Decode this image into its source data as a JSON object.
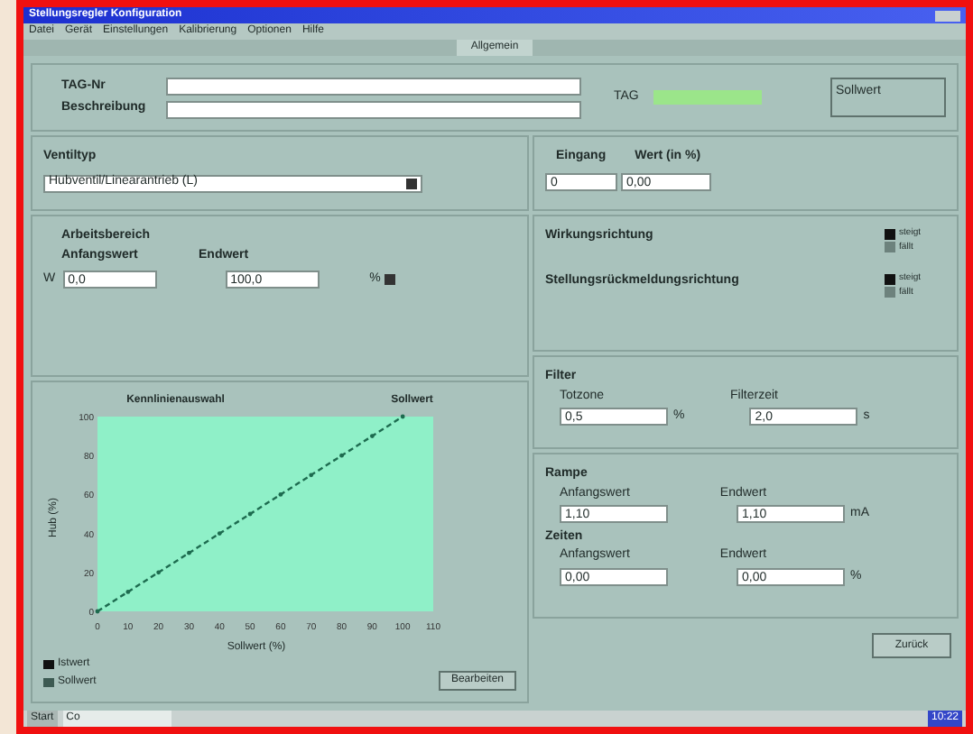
{
  "window": {
    "title": "Stellungsregler Konfiguration"
  },
  "menu": [
    "Datei",
    "Gerät",
    "Einstellungen",
    "Kalibrierung",
    "Optionen",
    "Hilfe"
  ],
  "tabs": [
    {
      "label": "Allgemein",
      "selected": true
    }
  ],
  "device": {
    "tag_label": "TAG-Nr",
    "description_label": "Beschreibung",
    "tag_value_label": "TAG",
    "status": "Sollwert"
  },
  "valve": {
    "label": "Ventiltyp",
    "value": "Hubventil/Linearantrieb (L)"
  },
  "position": {
    "label_1": "Eingang",
    "label_2": "Wert (in %)",
    "value_1": "0",
    "value_2": "0,00"
  },
  "range": {
    "label_start": "Arbeitsbereich Anfangswert",
    "label_end": "Endwert",
    "prefix": "W",
    "start": "0,0",
    "end": "100,0",
    "unit": "%"
  },
  "direction": [
    {
      "label": "Wirkungsrichtung",
      "options": [
        {
          "label": "steigt",
          "selected": true
        },
        {
          "label": "fällt",
          "selected": false
        }
      ]
    },
    {
      "label": "Stellungsrückmeldungsrichtung",
      "options": [
        {
          "label": "steigt",
          "selected": true
        },
        {
          "label": "fällt",
          "selected": false
        }
      ]
    }
  ],
  "filter": {
    "title": "Filter",
    "label_1": "Totzone",
    "value_1": "0,5",
    "unit_1": "%",
    "label_2": "Filterzeit",
    "value_2": "2,0",
    "unit_2": "s"
  },
  "ramp": {
    "title": "Rampe",
    "label_1": "Anfangswert",
    "value_1": "1,10",
    "label_2": "Endwert",
    "value_2": "1,10",
    "unit": "mA"
  },
  "timing": {
    "title": "Zeiten",
    "label_1": "Anfangswert",
    "value_1": "0,00",
    "label_2": "Endwert",
    "value_2": "0,00",
    "unit": "%"
  },
  "chart": {
    "header_left": "Kennlinienauswahl",
    "header_right": "Sollwert",
    "legend": [
      "Istwert",
      "Sollwert"
    ],
    "button": "Bearbeiten",
    "chart_data": {
      "type": "line",
      "xlabel": "Sollwert (%)",
      "ylabel": "Hub (%)",
      "x": [
        0,
        10,
        20,
        30,
        40,
        50,
        60,
        70,
        80,
        90,
        100
      ],
      "series": [
        {
          "color": "#1d6b4f",
          "line_style": "dashed",
          "values": [
            0,
            10,
            20,
            30,
            40,
            50,
            60,
            70,
            80,
            90,
            100
          ]
        }
      ],
      "xlim": [
        0,
        110
      ],
      "ylim": [
        0,
        100
      ],
      "xticks": [
        0,
        10,
        20,
        30,
        40,
        50,
        60,
        70,
        80,
        90,
        100,
        110
      ],
      "yticks": [
        0,
        20,
        40,
        60,
        80,
        100
      ]
    }
  },
  "close_button": "Zurück",
  "taskbar": {
    "start": "Start",
    "task": "Co",
    "clock": "10:22"
  }
}
